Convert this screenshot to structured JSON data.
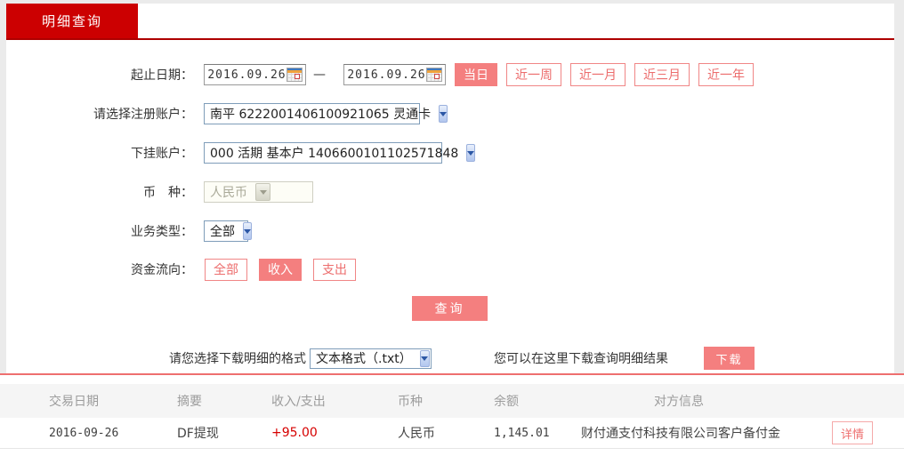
{
  "tab": {
    "label": "明细查询"
  },
  "form": {
    "date_label": "起止日期：",
    "date_from": "2016.09.26",
    "date_to": "2016.09.26",
    "date_separator": "—",
    "quick_buttons": [
      {
        "label": "当日",
        "active": true
      },
      {
        "label": "近一周",
        "active": false
      },
      {
        "label": "近一月",
        "active": false
      },
      {
        "label": "近三月",
        "active": false
      },
      {
        "label": "近一年",
        "active": false
      }
    ],
    "register_account_label": "请选择注册账户：",
    "register_account_value": "南平 6222001406100921065 灵通卡",
    "sub_account_label": "下挂账户：",
    "sub_account_value": "000 活期 基本户 1406600101102571848",
    "currency_label": "币　种：",
    "currency_value": "人民币",
    "business_type_label": "业务类型：",
    "business_type_value": "全部",
    "fund_flow_label": "资金流向：",
    "fund_flow_buttons": [
      {
        "label": "全部",
        "active": false
      },
      {
        "label": "收入",
        "active": true
      },
      {
        "label": "支出",
        "active": false
      }
    ],
    "query_button": "查询"
  },
  "download": {
    "format_label": "请您选择下载明细的格式",
    "format_value": "文本格式（.txt）",
    "hint": "您可以在这里下载查询明细结果",
    "button": "下载"
  },
  "table": {
    "headers": [
      "交易日期",
      "摘要",
      "收入/支出",
      "币种",
      "余额",
      "对方信息"
    ],
    "rows": [
      {
        "date": "2016-09-26",
        "summary": "DF提现",
        "amount": "+95.00",
        "currency": "人民币",
        "balance": "1,145.01",
        "counterparty": "财付通支付科技有限公司客户备付金",
        "action": "详情"
      }
    ]
  },
  "colors": {
    "brand_red": "#cc0001",
    "divider_red": "#ad0000",
    "pink_fill": "#f47f7f",
    "pink_text": "#ec6c6c",
    "amount_red": "#d60000",
    "table_line_red": "#ee6f6f",
    "page_bg": "#ebebeb",
    "header_bg": "#f5f5f5"
  }
}
